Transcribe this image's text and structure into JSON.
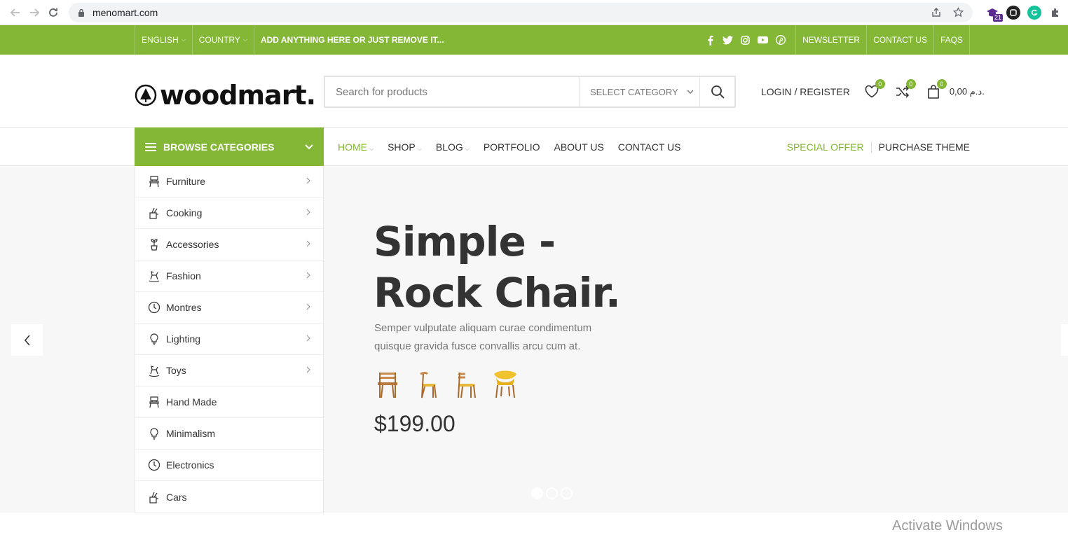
{
  "browser": {
    "url": "menomart.com",
    "ext_badge": "21"
  },
  "topbar": {
    "language": "ENGLISH",
    "country": "COUNTRY",
    "message": "ADD ANYTHING HERE OR JUST REMOVE IT...",
    "newsletter": "NEWSLETTER",
    "contact": "CONTACT US",
    "faqs": "FAQS",
    "background": "#83b735"
  },
  "header": {
    "logo_text": "woodmart.",
    "search_placeholder": "Search for products",
    "select_category": "SELECT CATEGORY",
    "login": "LOGIN / REGISTER",
    "wishlist_count": "0",
    "compare_count": "0",
    "cart_count": "0",
    "cart_total": "0,00 د.م."
  },
  "nav": {
    "browse_label": "BROWSE CATEGORIES",
    "items": [
      {
        "label": "HOME",
        "caret": true
      },
      {
        "label": "SHOP",
        "caret": true
      },
      {
        "label": "BLOG",
        "caret": true
      },
      {
        "label": "PORTFOLIO",
        "caret": false
      },
      {
        "label": "ABOUT US",
        "caret": false
      },
      {
        "label": "CONTACT US",
        "caret": false
      }
    ],
    "special_offer": "SPECIAL OFFER",
    "purchase_theme": "PURCHASE THEME"
  },
  "categories": [
    {
      "label": "Furniture",
      "icon": "chair-icon",
      "has_sub": true
    },
    {
      "label": "Cooking",
      "icon": "cooking-icon",
      "has_sub": true
    },
    {
      "label": "Accessories",
      "icon": "plant-icon",
      "has_sub": true
    },
    {
      "label": "Fashion",
      "icon": "rocking-horse-icon",
      "has_sub": true
    },
    {
      "label": "Montres",
      "icon": "clock-icon",
      "has_sub": true
    },
    {
      "label": "Lighting",
      "icon": "bulb-icon",
      "has_sub": true
    },
    {
      "label": "Toys",
      "icon": "rocking-horse-icon",
      "has_sub": true
    },
    {
      "label": "Hand Made",
      "icon": "chair-icon",
      "has_sub": false
    },
    {
      "label": "Minimalism",
      "icon": "bulb-icon",
      "has_sub": false
    },
    {
      "label": "Electronics",
      "icon": "clock-icon",
      "has_sub": false
    },
    {
      "label": "Cars",
      "icon": "cooking-icon",
      "has_sub": false
    }
  ],
  "slide": {
    "title_line1": "Simple -",
    "title_line2": "Rock Chair.",
    "description": "Semper vulputate aliquam curae condimentum quisque gravida fusce convallis arcu cum at.",
    "price": "$199.00",
    "active_dot": 1,
    "dot_count": 3
  },
  "watermark": "Activate Windows"
}
